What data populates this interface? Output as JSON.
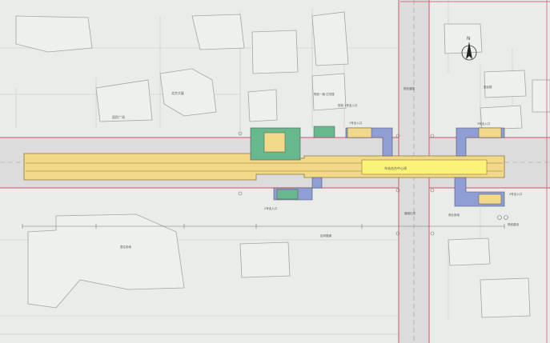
{
  "map": {
    "north_label": "N",
    "labels": {
      "block_nw": "北京大厦",
      "block_nw2": "居民广场",
      "sign_north_mid": "规划一路 住宅楼",
      "sign_mid_center": "规划 1号出入口",
      "entrance1": "1号出入口",
      "entrance2": "2号出入口",
      "entrance3": "3号出入口",
      "entrance4": "4号出入口",
      "station_label": "车站站台中心线",
      "cross_north": "规划道路",
      "block_ne": "居民楼",
      "block_se": "商业用地",
      "block_sw": "居住用地",
      "scale_south": "区间隧道",
      "note_se": "规划建设",
      "note_road": "道路红线"
    }
  },
  "colors": {
    "background": "#e9ece9",
    "road_edge": "#d46f82",
    "road_fill": "#dcdcdc",
    "station_fill": "#f2d889",
    "platform_fill": "#fbf27a",
    "entrance_blue": "#8f9fd6",
    "entrance_green": "#67b88c",
    "building_line": "#a4a4a4"
  }
}
